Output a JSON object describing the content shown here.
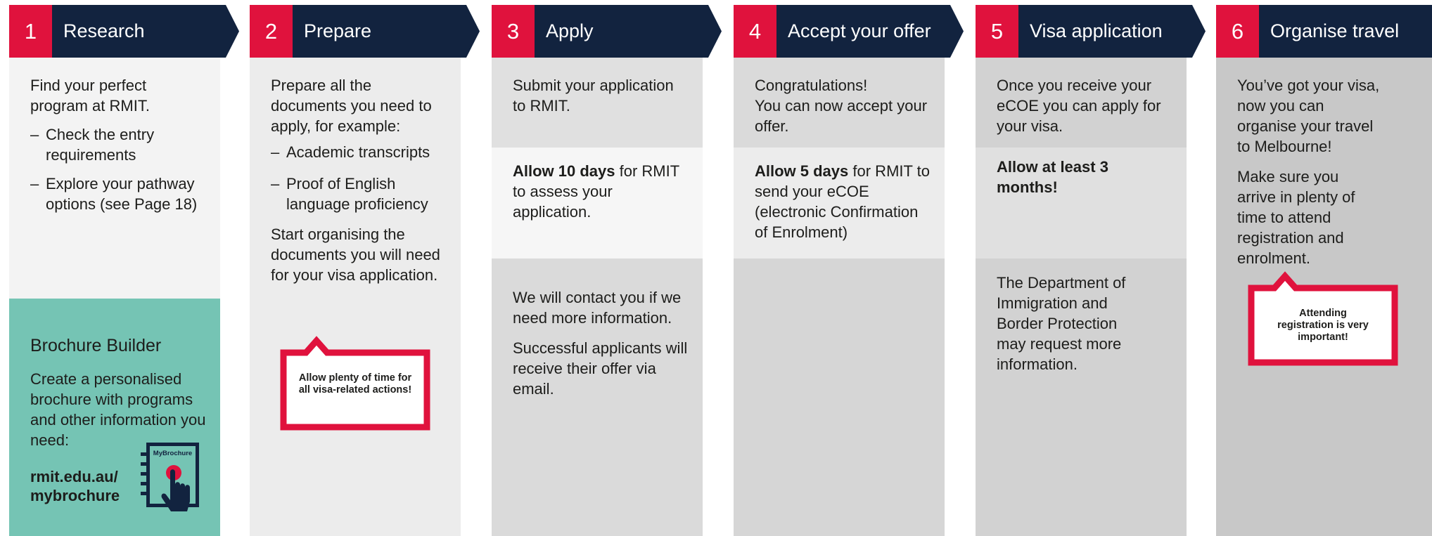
{
  "colors": {
    "navy": "#12233f",
    "red": "#e0123d",
    "teal": "#75c4b4"
  },
  "steps": [
    {
      "number": "1",
      "title": "Research",
      "intro": "Find your perfect program at RMIT.",
      "bullets": [
        "Check the entry requirements",
        "Explore your pathway options (see Page 18)"
      ]
    },
    {
      "number": "2",
      "title": "Prepare",
      "intro": "Prepare all the documents you need to apply, for example:",
      "bullets": [
        "Academic transcripts",
        "Proof of English language proficiency"
      ],
      "outro": "Start organising the documents you will need for your visa application.",
      "callout": "Allow plenty of time for all visa-related actions!"
    },
    {
      "number": "3",
      "title": "Apply",
      "intro": "Submit your application to RMIT.",
      "highlight_bold": "Allow 10 days",
      "highlight_rest": " for RMIT to assess your application.",
      "notes": [
        "We will contact you if we need more information.",
        "Successful applicants will receive their offer via email."
      ]
    },
    {
      "number": "4",
      "title": "Accept your offer",
      "intro_line1": "Congratulations!",
      "intro_line2": "You can now accept your offer.",
      "highlight_bold": "Allow 5 days",
      "highlight_rest": " for RMIT to send your eCOE (electronic Confirmation of Enrolment)"
    },
    {
      "number": "5",
      "title": "Visa application",
      "intro": "Once you receive your eCOE you can apply for your visa.",
      "highlight_bold": "Allow at least 3 months!",
      "note": "The Department of Immigration and Border Protection may request more information."
    },
    {
      "number": "6",
      "title": "Organise travel",
      "intro": "You’ve got your visa, now you can organise your travel to Melbourne!",
      "outro": "Make sure you arrive in plenty of time to attend registration and enrolment.",
      "callout": "Attending registration is very important!"
    }
  ],
  "brochure": {
    "title": "Brochure Builder",
    "text": "Create a personalised brochure with programs and other information you need:",
    "link": "rmit.edu.au/ mybrochure",
    "icon_label": "MyBrochure"
  }
}
